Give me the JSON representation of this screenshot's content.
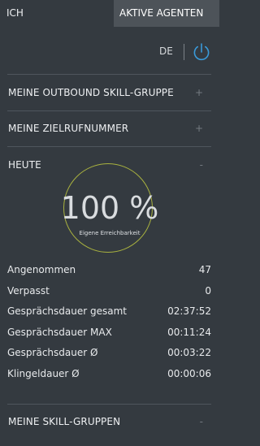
{
  "tabs": [
    {
      "label": "ICH"
    },
    {
      "label": "AKTIVE AGENTEN"
    }
  ],
  "header": {
    "language": "DE"
  },
  "sections": {
    "outbound": {
      "title": "MEINE OUTBOUND SKILL-GRUPPE",
      "toggle": "+"
    },
    "target": {
      "title": "MEINE ZIELRUFNUMMER",
      "toggle": "+"
    },
    "today": {
      "title": "HEUTE",
      "toggle": "-"
    },
    "skill_groups": {
      "title": "MEINE SKILL-GRUPPEN",
      "toggle": "-"
    }
  },
  "availability": {
    "value": "100 %",
    "caption": "Eigene Erreichbarkeit"
  },
  "stats": [
    {
      "label": "Angenommen",
      "value": "47"
    },
    {
      "label": "Verpasst",
      "value": "0"
    },
    {
      "label": "Gesprächsdauer gesamt",
      "value": "02:37:52"
    },
    {
      "label": "Gesprächsdauer MAX",
      "value": "00:11:24"
    },
    {
      "label": "Gesprächsdauer Ø",
      "value": "00:03:22"
    },
    {
      "label": "Klingeldauer Ø",
      "value": "00:00:06"
    }
  ],
  "colors": {
    "background": "#343a40",
    "active_tab": "#4d5359",
    "ring": "#a9b23f",
    "power_icon": "#3a9ad9"
  }
}
